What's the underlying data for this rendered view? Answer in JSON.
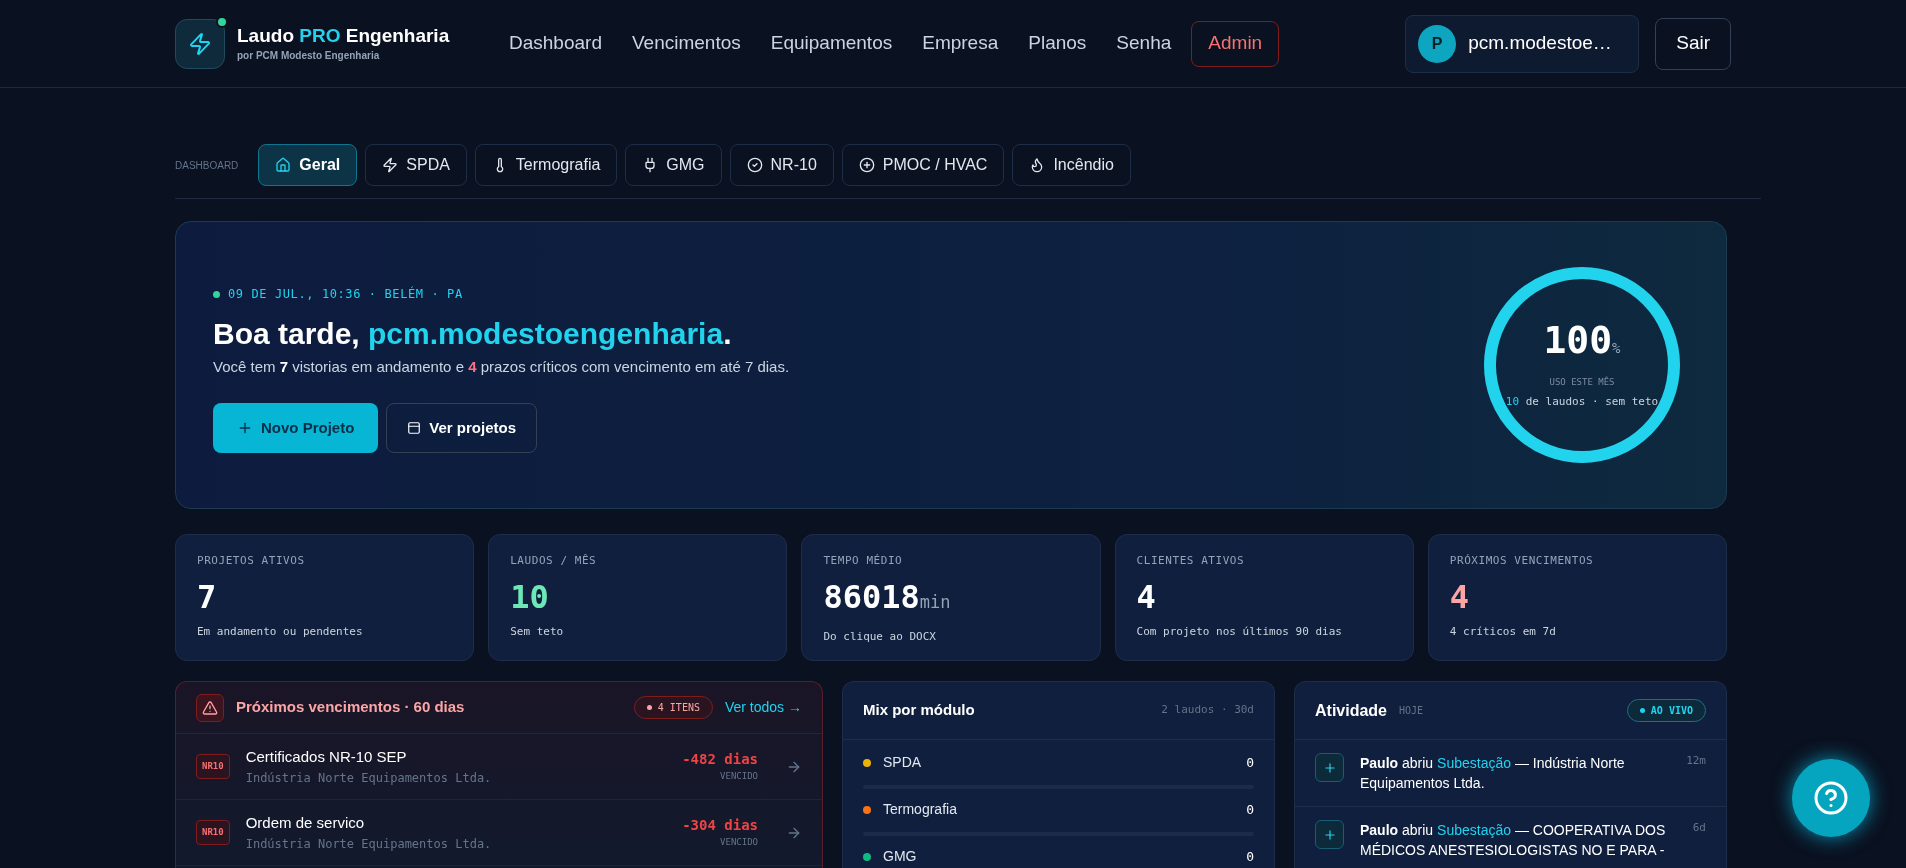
{
  "brand": {
    "name_start": "Laudo ",
    "name_highlight": "PRO",
    "name_end": " Engenharia",
    "tagline": "por PCM Modesto Engenharia"
  },
  "nav": [
    {
      "label": "Dashboard",
      "kind": "link"
    },
    {
      "label": "Vencimentos",
      "kind": "link"
    },
    {
      "label": "Equipamentos",
      "kind": "link"
    },
    {
      "label": "Empresa",
      "kind": "link"
    },
    {
      "label": "Planos",
      "kind": "link"
    },
    {
      "label": "Senha",
      "kind": "link"
    },
    {
      "label": "Admin",
      "kind": "admin"
    }
  ],
  "user": {
    "initial": "P",
    "name": "pcm.modestoe…"
  },
  "logout": "Sair",
  "section_label": "DASHBOARD",
  "tabs": [
    {
      "label": "Geral",
      "selected": true
    },
    {
      "label": "SPDA",
      "selected": false
    },
    {
      "label": "Termografia",
      "selected": false
    },
    {
      "label": "GMG",
      "selected": false
    },
    {
      "label": "NR-10",
      "selected": false
    },
    {
      "label": "PMOC / HVAC",
      "selected": false
    },
    {
      "label": "Incêndio",
      "selected": false
    }
  ],
  "hero": {
    "timestamp": "09 DE JUL., 10:36 · BELÉM · PA",
    "greeting": "Boa tarde, ",
    "username": "pcm.modestoengenharia",
    "greeting_end": ".",
    "summary": [
      {
        "text": "Você tem ",
        "kind": "plain"
      },
      {
        "text": "7",
        "kind": "count"
      },
      {
        "text": " vistorias em andamento e ",
        "kind": "plain"
      },
      {
        "text": "4",
        "kind": "alert"
      },
      {
        "text": " prazos críticos com vencimento em até 7 dias.",
        "kind": "plain"
      }
    ],
    "primary_button": "Novo Projeto",
    "secondary_button": "Ver projetos",
    "usage": {
      "level": 1,
      "value": "100",
      "unit": "%",
      "label": "USO ESTE MÊS",
      "count": "10",
      "caption": " de laudos · sem teto"
    }
  },
  "stats": [
    {
      "label": "PROJETOS ATIVOS",
      "value": "7",
      "color": "#ffffff",
      "caption": "Em andamento ou pendentes"
    },
    {
      "label": "LAUDOS / MÊS",
      "value": "10",
      "color": "#6ee7b7",
      "caption": "Sem teto"
    },
    {
      "label": "TEMPO MÉDIO",
      "value": "86018",
      "unit": "min",
      "color": "#ffffff",
      "caption": "Do clique ao DOCX"
    },
    {
      "label": "CLIENTES ATIVOS",
      "value": "4",
      "color": "#ffffff",
      "caption": "Com projeto nos últimos 90 dias"
    },
    {
      "label": "PRÓXIMOS VENCIMENTOS",
      "value": "4",
      "color": "#fca5a5",
      "caption": "4 críticos em 7d"
    }
  ],
  "deadlines": {
    "title": "Próximos vencimentos · 60 dias",
    "badge": "4 ITENS",
    "link": "Ver todos →",
    "rows": [
      {
        "tag": "NR10",
        "title": "Certificados NR-10 SEP",
        "company": "Indústria Norte Equipamentos Ltda.",
        "days": "-482 dias",
        "status": "VENCIDO"
      },
      {
        "tag": "NR10",
        "title": "Ordem de servico",
        "company": "Indústria Norte Equipamentos Ltda.",
        "days": "-304 dias",
        "status": "VENCIDO"
      }
    ]
  },
  "mix": {
    "title": "Mix por módulo",
    "meta": "2 laudos · 30d",
    "items": [
      {
        "name": "SPDA",
        "count": "0",
        "color": "#eab308"
      },
      {
        "name": "Termografia",
        "count": "0",
        "color": "#f97316"
      },
      {
        "name": "GMG",
        "count": "0",
        "color": "#10b981"
      }
    ]
  },
  "activity": {
    "title": "Atividade",
    "subtitle": "HOJE",
    "badge": "AO VIVO",
    "items": [
      {
        "actor": "Paulo",
        "verb": " abriu ",
        "target": "Subestação",
        "rest": " — Indústria Norte Equipamentos Ltda.",
        "time": "12m"
      },
      {
        "actor": "Paulo",
        "verb": " abriu ",
        "target": "Subestação",
        "rest": " — COOPERATIVA DOS MÉDICOS ANESTESIOLOGISTAS NO E PARA -",
        "time": "6d"
      }
    ]
  }
}
